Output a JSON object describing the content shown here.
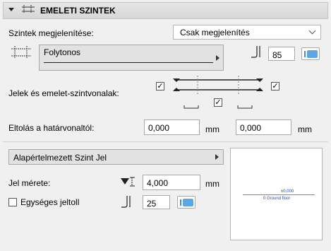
{
  "header": {
    "title": "EMELETI SZINTEK"
  },
  "display_row": {
    "label": "Szintek megjelenítése:",
    "selected": "Csak megjelenítés"
  },
  "line_row": {
    "line_type": "Folytonos",
    "pen_value": "85"
  },
  "markers_row": {
    "label": "Jelek és emelet-szintvonalak:"
  },
  "offset_row": {
    "label": "Eltolás a határvonaltól:",
    "value1": "0,000",
    "unit1": "mm",
    "value2": "0,000",
    "unit2": "mm"
  },
  "marker_section": {
    "label": "Alapértelmezett Szint Jel"
  },
  "size_row": {
    "label": "Jel mérete:",
    "value": "4,000",
    "unit": "mm"
  },
  "uniform_row": {
    "label": "Egységes jeltoll",
    "pen_value": "25"
  },
  "preview": {
    "elevation": "±0,000",
    "level_name": "0 Ground floor"
  },
  "colors": {
    "accent": "#3a8fe0",
    "preview_text": "#1f4fa8",
    "preview_line": "#3aa0c8"
  },
  "icons": [
    "collapse-arrow-icon",
    "story-level-icon",
    "line-type-icon",
    "pen-icon",
    "marker-size-icon",
    "chevron-down-icon",
    "chevron-right-icon"
  ]
}
